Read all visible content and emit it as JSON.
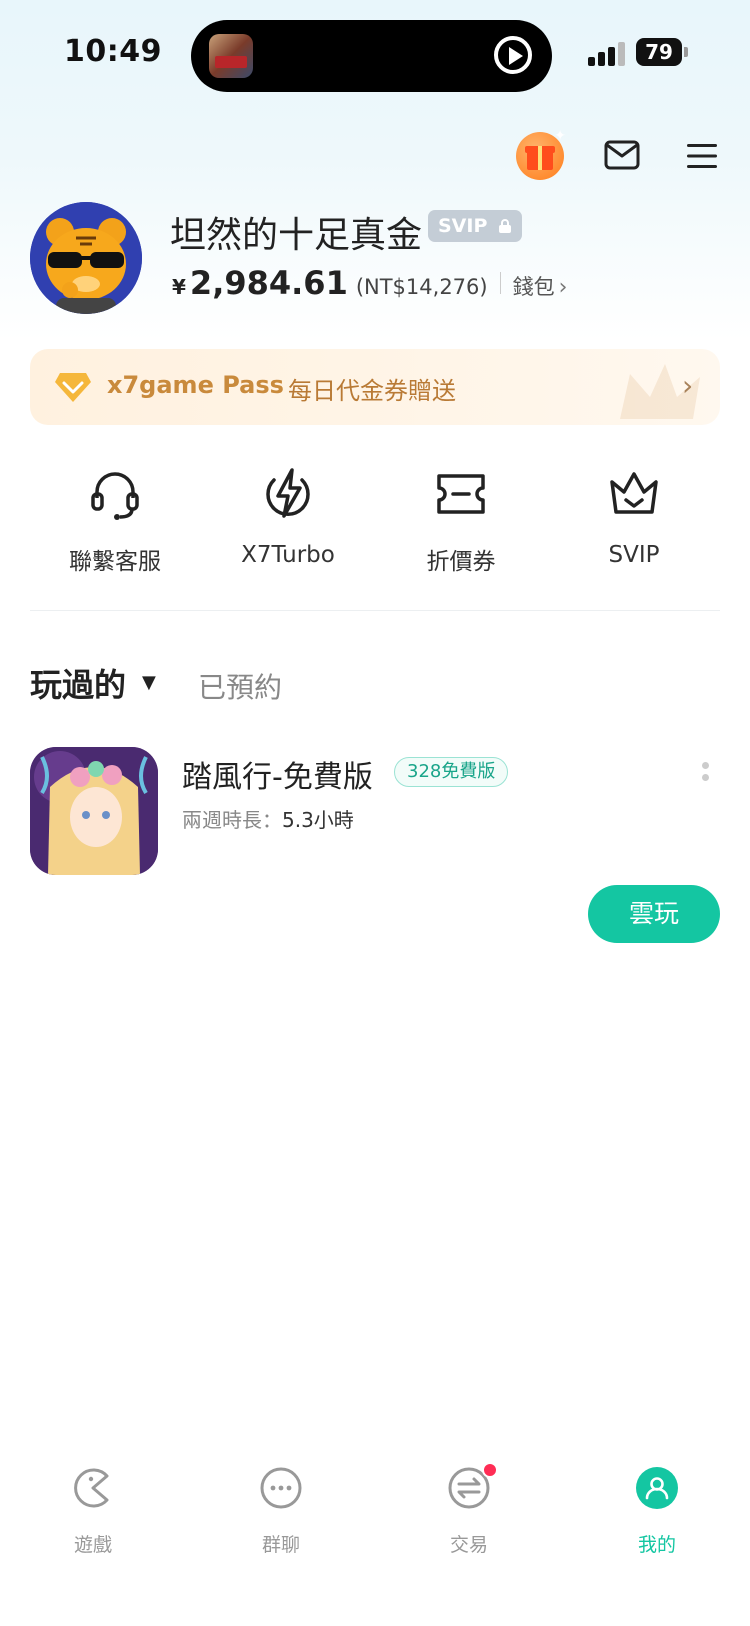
{
  "status_bar": {
    "time": "10:49",
    "battery": "79"
  },
  "header": {
    "icons": [
      "gift-icon",
      "mail-icon",
      "menu-icon"
    ]
  },
  "profile": {
    "username": "坦然的十足真金",
    "svip_badge": "SVIP",
    "currency_symbol": "¥",
    "balance": "2,984.61",
    "balance_ntd": "(NT$14,276)",
    "wallet_label": "錢包"
  },
  "pass_banner": {
    "title": "x7game Pass",
    "description": "每日代金券贈送"
  },
  "quick_actions": [
    {
      "label": "聯繫客服",
      "icon": "headset-icon"
    },
    {
      "label": "X7Turbo",
      "icon": "turbo-icon"
    },
    {
      "label": "折價券",
      "icon": "coupon-icon"
    },
    {
      "label": "SVIP",
      "icon": "crown-icon"
    }
  ],
  "tabs": {
    "played": "玩過的",
    "reserved": "已預約"
  },
  "games": [
    {
      "title": "踏風行-免費版",
      "tag": "328免費版",
      "meta_label": "兩週時長：",
      "meta_value": "5.3小時",
      "action": "雲玩"
    }
  ],
  "bottom_nav": [
    {
      "label": "遊戲",
      "icon": "game-icon",
      "active": false
    },
    {
      "label": "群聊",
      "icon": "chat-icon",
      "active": false
    },
    {
      "label": "交易",
      "icon": "trade-icon",
      "active": false,
      "badge": true
    },
    {
      "label": "我的",
      "icon": "profile-icon",
      "active": true
    }
  ],
  "colors": {
    "accent": "#14c6a2",
    "pass_text": "#c98a3c",
    "badge_red": "#ff2d55",
    "svip_gray": "#c4cdd6"
  }
}
